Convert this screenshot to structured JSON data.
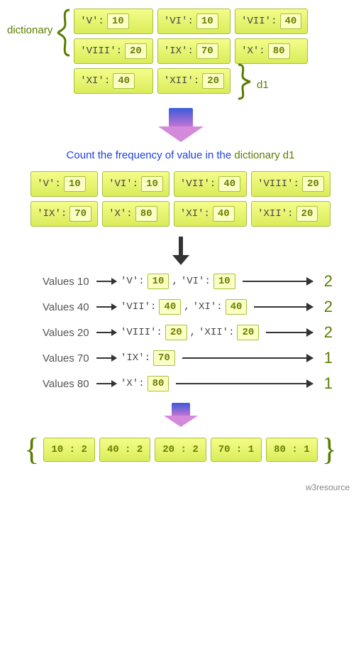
{
  "labels": {
    "dictionary": "dictionary",
    "d1": "d1",
    "caption_blue": "Count the frequency of value in the ",
    "caption_green": "dictionary d1",
    "footer": "w3resource"
  },
  "dict_top": [
    [
      {
        "k": "'V'",
        "v": "10"
      },
      {
        "k": "'VI'",
        "v": "10"
      },
      {
        "k": "'VII'",
        "v": "40"
      }
    ],
    [
      {
        "k": "'VIII'",
        "v": "20"
      },
      {
        "k": "'IX'",
        "v": "70"
      },
      {
        "k": "'X'",
        "v": "80"
      }
    ],
    [
      {
        "k": "'XI'",
        "v": "40"
      },
      {
        "k": "'XII'",
        "v": "20"
      }
    ]
  ],
  "dict_flat": [
    {
      "k": "'V'",
      "v": "10"
    },
    {
      "k": "'VI'",
      "v": "10"
    },
    {
      "k": "'VII'",
      "v": "40"
    },
    {
      "k": "'VIII'",
      "v": "20"
    },
    {
      "k": "'IX'",
      "v": "70"
    },
    {
      "k": "'X'",
      "v": "80"
    },
    {
      "k": "'XI'",
      "v": "40"
    },
    {
      "k": "'XII'",
      "v": "20"
    }
  ],
  "freq": [
    {
      "label": "Values 10",
      "pairs": [
        {
          "k": "'V'",
          "v": "10"
        },
        {
          "k": "'VI'",
          "v": "10"
        }
      ],
      "count": "2"
    },
    {
      "label": "Values 40",
      "pairs": [
        {
          "k": "'VII'",
          "v": "40"
        },
        {
          "k": "'XI'",
          "v": "40"
        }
      ],
      "count": "2"
    },
    {
      "label": "Values 20",
      "pairs": [
        {
          "k": "'VIII'",
          "v": "20"
        },
        {
          "k": "'XII'",
          "v": "20"
        }
      ],
      "count": "2"
    },
    {
      "label": "Values 70",
      "pairs": [
        {
          "k": "'IX'",
          "v": "70"
        }
      ],
      "count": "1"
    },
    {
      "label": "Values 80",
      "pairs": [
        {
          "k": "'X'",
          "v": "80"
        }
      ],
      "count": "1"
    }
  ],
  "result": [
    {
      "k": "10",
      "v": "2"
    },
    {
      "k": "40",
      "v": "2"
    },
    {
      "k": "20",
      "v": "2"
    },
    {
      "k": "70",
      "v": "1"
    },
    {
      "k": "80",
      "v": "1"
    }
  ],
  "chart_data": {
    "type": "table",
    "title": "Count the frequency of value in the dictionary d1",
    "input_dictionary": {
      "V": 10,
      "VI": 10,
      "VII": 40,
      "VIII": 20,
      "IX": 70,
      "X": 80,
      "XI": 40,
      "XII": 20
    },
    "frequency": {
      "10": 2,
      "40": 2,
      "20": 2,
      "70": 1,
      "80": 1
    }
  }
}
